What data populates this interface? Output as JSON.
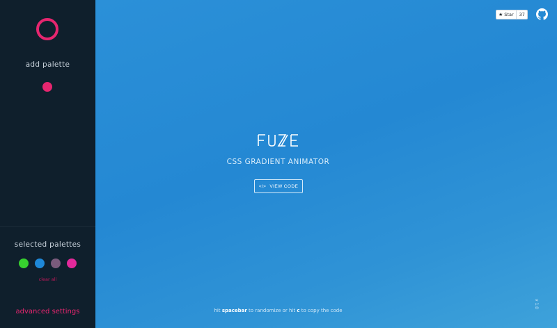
{
  "sidebar": {
    "add_palette_label": "add palette",
    "selected_palettes_label": "selected palettes",
    "clear_all_label": "clear all",
    "advanced_settings_label": "advanced settings",
    "accent_color": "#e6266f",
    "selected_swatches": [
      {
        "color": "#37d12f",
        "name": "green"
      },
      {
        "color": "#1e88d8",
        "name": "blue"
      },
      {
        "color": "#7a5b7c",
        "name": "mauve"
      },
      {
        "color": "#e3299b",
        "name": "magenta"
      }
    ]
  },
  "main": {
    "brand": "FUZE",
    "subtitle": "CSS GRADIENT ANIMATOR",
    "view_code_label": "VIEW CODE",
    "view_code_icon": "code-icon",
    "hint_prefix": "hit",
    "hint_key1": "spacebar",
    "hint_mid": "to randomize or hit",
    "hint_key2": "c",
    "hint_suffix": "to copy the code",
    "version": "v 1.0"
  },
  "github": {
    "star_label": "Star",
    "star_count": "37",
    "icon": "github-icon"
  }
}
